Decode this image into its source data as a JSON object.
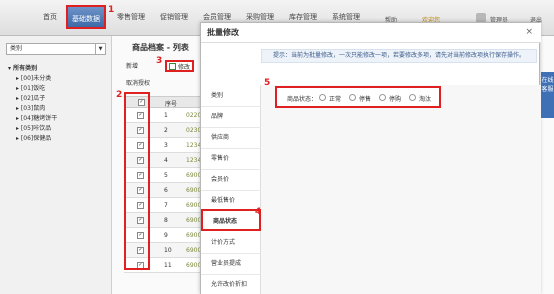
{
  "nav": {
    "items": [
      "首页",
      "基础数据",
      "零售管理",
      "促销管理",
      "会员管理",
      "采购管理",
      "库存管理",
      "系统管理"
    ],
    "help": "帮助",
    "user_area": "欢迎您",
    "username": "管理员",
    "logout": "退出",
    "step1": "1"
  },
  "left": {
    "category_select": "类别",
    "tree_root": "▾ 所有类别",
    "tree": [
      "▸ [00]未分类",
      "▸ [01]饭吃",
      "▸ [02]瓜子",
      "▸ [03]鼠肉",
      "▸ [04]糖烤饼干",
      "▸ [05]咔饮品",
      "▸ [06]保健品"
    ]
  },
  "list": {
    "title": "商品档案 - 列表",
    "new_btn": "新增",
    "edit_btn": "修改",
    "cancel_btn": "取消授权",
    "step2": "2",
    "step3": "3",
    "header_num": "序号",
    "rows": [
      {
        "num": "1",
        "code": "0220"
      },
      {
        "num": "2",
        "code": "0230"
      },
      {
        "num": "3",
        "code": "1234"
      },
      {
        "num": "4",
        "code": "1234"
      },
      {
        "num": "5",
        "code": "6900"
      },
      {
        "num": "6",
        "code": "6900"
      },
      {
        "num": "7",
        "code": "6900"
      },
      {
        "num": "8",
        "code": "6900"
      },
      {
        "num": "9",
        "code": "6900"
      },
      {
        "num": "10",
        "code": "6900"
      },
      {
        "num": "11",
        "code": "6900"
      }
    ]
  },
  "modal": {
    "title": "批量修改",
    "close": "×",
    "tip": "提示：当前为批量修改，一次只能修改一项，若要修改多项，请先对当前修改项执行保存操作。",
    "fields": [
      "类别",
      "品牌",
      "供应商",
      "零售价",
      "会员价",
      "最低售价",
      "商品状态",
      "计价方式",
      "营业员提成",
      "允许改价折扣"
    ],
    "selected_field": "商品状态",
    "step4": "4",
    "step5": "5",
    "status_label": "商品状态：",
    "status_options": [
      "正常",
      "停售",
      "停购",
      "淘汰"
    ]
  },
  "side_tab": "在线客服"
}
